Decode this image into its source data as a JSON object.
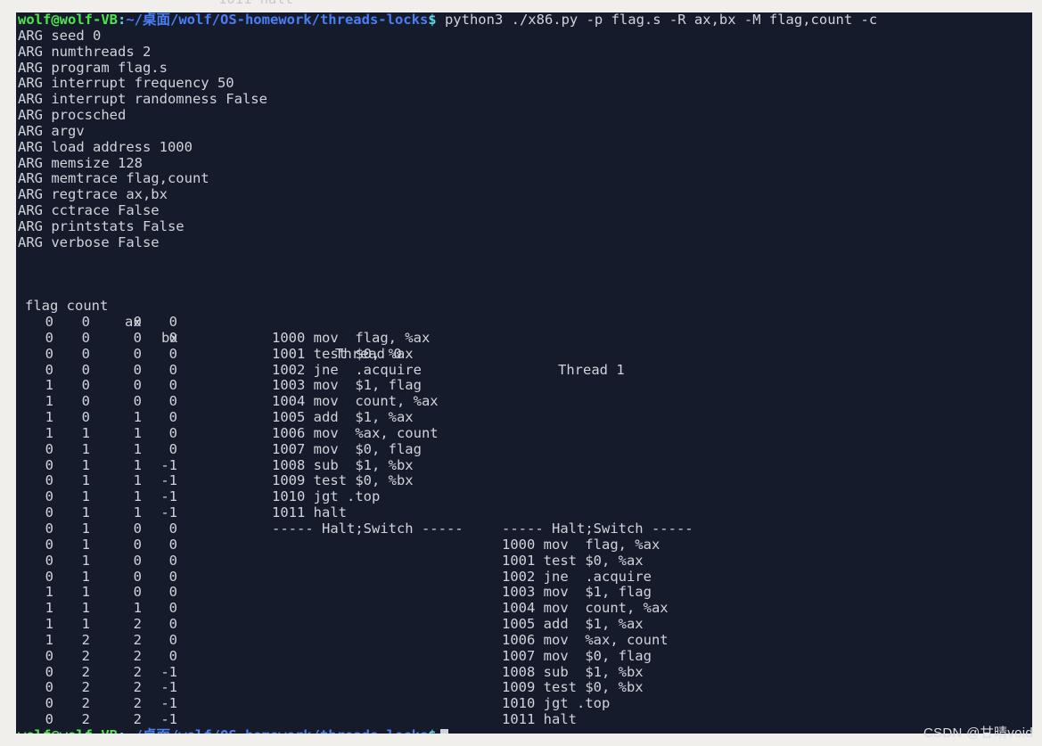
{
  "window": {
    "title": "wolf@wolf-VB: ~/桌面/wolf/OS-homework/threads-locks",
    "background": "#161b2b",
    "foreground": "#cfd3da",
    "page_background": "#f1efec"
  },
  "top_sliver": {
    "text": "1011 halt"
  },
  "prompt": {
    "user_host": "wolf@wolf-VB",
    "colon": ":",
    "path": "~/桌面/wolf/OS-homework/threads-locks",
    "dollar": "$",
    "colors": {
      "user_host": "#4ee44e",
      "colon": "#5fd7e8",
      "path": "#4a7ef5",
      "dollar": "#5fd7e8"
    }
  },
  "command": {
    "text": " python3 ./x86.py -p flag.s -R ax,bx -M flag,count -c"
  },
  "args": [
    "ARG seed 0",
    "ARG numthreads 2",
    "ARG program flag.s",
    "ARG interrupt frequency 50",
    "ARG interrupt randomness False",
    "ARG procsched",
    "ARG argv",
    "ARG load address 1000",
    "ARG memsize 128",
    "ARG memtrace flag,count",
    "ARG regtrace ax,bx",
    "ARG cctrace False",
    "ARG printstats False",
    "ARG verbose False"
  ],
  "table": {
    "headers": {
      "flag_count": "flag count",
      "ax": "ax",
      "bx": "bx",
      "thread0": "Thread 0",
      "thread1": "Thread 1"
    },
    "rows": [
      {
        "flag": "0",
        "count": "0",
        "ax": "0",
        "bx": "0",
        "t0": "",
        "t1": ""
      },
      {
        "flag": "0",
        "count": "0",
        "ax": "0",
        "bx": "0",
        "t0": "1000 mov  flag, %ax",
        "t1": ""
      },
      {
        "flag": "0",
        "count": "0",
        "ax": "0",
        "bx": "0",
        "t0": "1001 test $0, %ax",
        "t1": ""
      },
      {
        "flag": "0",
        "count": "0",
        "ax": "0",
        "bx": "0",
        "t0": "1002 jne  .acquire",
        "t1": ""
      },
      {
        "flag": "1",
        "count": "0",
        "ax": "0",
        "bx": "0",
        "t0": "1003 mov  $1, flag",
        "t1": ""
      },
      {
        "flag": "1",
        "count": "0",
        "ax": "0",
        "bx": "0",
        "t0": "1004 mov  count, %ax",
        "t1": ""
      },
      {
        "flag": "1",
        "count": "0",
        "ax": "1",
        "bx": "0",
        "t0": "1005 add  $1, %ax",
        "t1": ""
      },
      {
        "flag": "1",
        "count": "1",
        "ax": "1",
        "bx": "0",
        "t0": "1006 mov  %ax, count",
        "t1": ""
      },
      {
        "flag": "0",
        "count": "1",
        "ax": "1",
        "bx": "0",
        "t0": "1007 mov  $0, flag",
        "t1": ""
      },
      {
        "flag": "0",
        "count": "1",
        "ax": "1",
        "bx": "-1",
        "t0": "1008 sub  $1, %bx",
        "t1": ""
      },
      {
        "flag": "0",
        "count": "1",
        "ax": "1",
        "bx": "-1",
        "t0": "1009 test $0, %bx",
        "t1": ""
      },
      {
        "flag": "0",
        "count": "1",
        "ax": "1",
        "bx": "-1",
        "t0": "1010 jgt .top",
        "t1": ""
      },
      {
        "flag": "0",
        "count": "1",
        "ax": "1",
        "bx": "-1",
        "t0": "1011 halt",
        "t1": ""
      },
      {
        "flag": "0",
        "count": "1",
        "ax": "0",
        "bx": "0",
        "t0": "----- Halt;Switch -----",
        "t1": "----- Halt;Switch -----"
      },
      {
        "flag": "0",
        "count": "1",
        "ax": "0",
        "bx": "0",
        "t0": "",
        "t1": "1000 mov  flag, %ax"
      },
      {
        "flag": "0",
        "count": "1",
        "ax": "0",
        "bx": "0",
        "t0": "",
        "t1": "1001 test $0, %ax"
      },
      {
        "flag": "0",
        "count": "1",
        "ax": "0",
        "bx": "0",
        "t0": "",
        "t1": "1002 jne  .acquire"
      },
      {
        "flag": "1",
        "count": "1",
        "ax": "0",
        "bx": "0",
        "t0": "",
        "t1": "1003 mov  $1, flag"
      },
      {
        "flag": "1",
        "count": "1",
        "ax": "1",
        "bx": "0",
        "t0": "",
        "t1": "1004 mov  count, %ax"
      },
      {
        "flag": "1",
        "count": "1",
        "ax": "2",
        "bx": "0",
        "t0": "",
        "t1": "1005 add  $1, %ax"
      },
      {
        "flag": "1",
        "count": "2",
        "ax": "2",
        "bx": "0",
        "t0": "",
        "t1": "1006 mov  %ax, count"
      },
      {
        "flag": "0",
        "count": "2",
        "ax": "2",
        "bx": "0",
        "t0": "",
        "t1": "1007 mov  $0, flag"
      },
      {
        "flag": "0",
        "count": "2",
        "ax": "2",
        "bx": "-1",
        "t0": "",
        "t1": "1008 sub  $1, %bx"
      },
      {
        "flag": "0",
        "count": "2",
        "ax": "2",
        "bx": "-1",
        "t0": "",
        "t1": "1009 test $0, %bx"
      },
      {
        "flag": "0",
        "count": "2",
        "ax": "2",
        "bx": "-1",
        "t0": "",
        "t1": "1010 jgt .top"
      },
      {
        "flag": "0",
        "count": "2",
        "ax": "2",
        "bx": "-1",
        "t0": "",
        "t1": "1011 halt"
      }
    ]
  },
  "watermark": {
    "text": "CSDN @甘晴void"
  }
}
